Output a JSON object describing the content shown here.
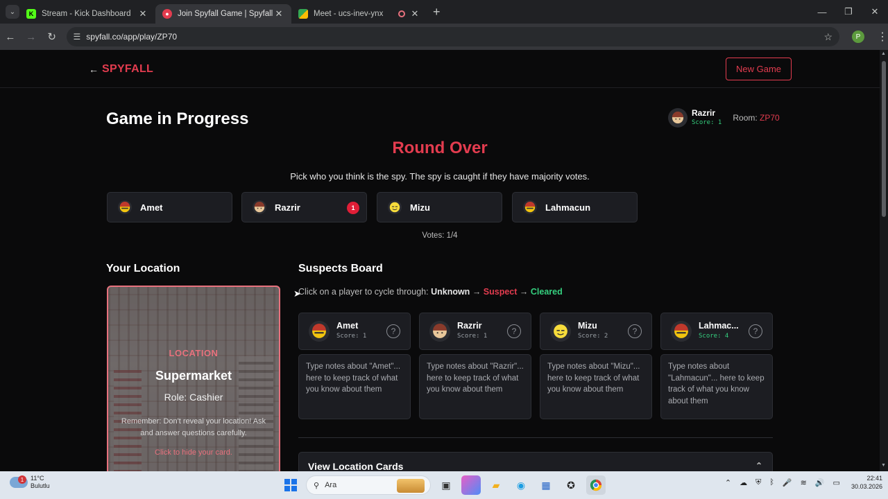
{
  "browser": {
    "tabs": [
      {
        "label": "Stream - Kick Dashboard",
        "icon": "kick-icon",
        "active": false
      },
      {
        "label": "Join Spyfall Game | Spyfall Onli",
        "icon": "spyfall-icon",
        "active": true
      },
      {
        "label": "Meet - ucs-inev-ynx",
        "icon": "meet-icon",
        "active": false
      }
    ],
    "url": "spyfall.co/app/play/ZP70",
    "profile_initial": "P"
  },
  "header": {
    "logo": "SPYFALL",
    "new_game_label": "New Game"
  },
  "game": {
    "title": "Game in Progress",
    "player_name": "Razrir",
    "player_score": "Score: 1",
    "room_label": "Room:",
    "room_code": "ZP70",
    "round_status": "Round Over",
    "instructions": "Pick who you think is the spy. The spy is caught if they have majority votes.",
    "vote_players": [
      {
        "name": "Amet",
        "votes": ""
      },
      {
        "name": "Razrir",
        "votes": "1"
      },
      {
        "name": "Mizu",
        "votes": ""
      },
      {
        "name": "Lahmacun",
        "votes": ""
      }
    ],
    "votes_text": "Votes: 1/4"
  },
  "location": {
    "heading": "Your Location",
    "label": "LOCATION",
    "name": "Supermarket",
    "role": "Role: Cashier",
    "reminder": "Remember: Don't reveal your location! Ask and answer questions carefully.",
    "hide_hint": "Click to hide your card."
  },
  "suspects": {
    "heading": "Suspects Board",
    "cycle_prefix": "Click on a player to cycle through:",
    "cycle_unknown": "Unknown",
    "arrow": "→",
    "cycle_suspect": "Suspect",
    "cycle_cleared": "Cleared",
    "players": [
      {
        "name": "Amet",
        "score": "Score: 1",
        "note": "Type notes about \"Amet\"... here to keep track of what you know about them"
      },
      {
        "name": "Razrir",
        "score": "Score: 1",
        "note": "Type notes about \"Razrir\"... here to keep track of what you know about them"
      },
      {
        "name": "Mizu",
        "score": "Score: 2",
        "note": "Type notes about \"Mizu\"... here to keep track of what you know about them"
      },
      {
        "name": "Lahmac...",
        "score": "Score: 4",
        "note": "Type notes about \"Lahmacun\"... here to keep track of what you know about them"
      }
    ],
    "view_cards_label": "View Location Cards"
  },
  "taskbar": {
    "weather_temp": "11°C",
    "weather_desc": "Bulutlu",
    "weather_badge": "1",
    "search_placeholder": "Ara",
    "time": "22:41",
    "date": "30.03.2026"
  },
  "colors": {
    "accent": "#e33c4f",
    "cleared": "#35d07f",
    "background": "#0a0a0b",
    "card": "#1c1d22"
  }
}
